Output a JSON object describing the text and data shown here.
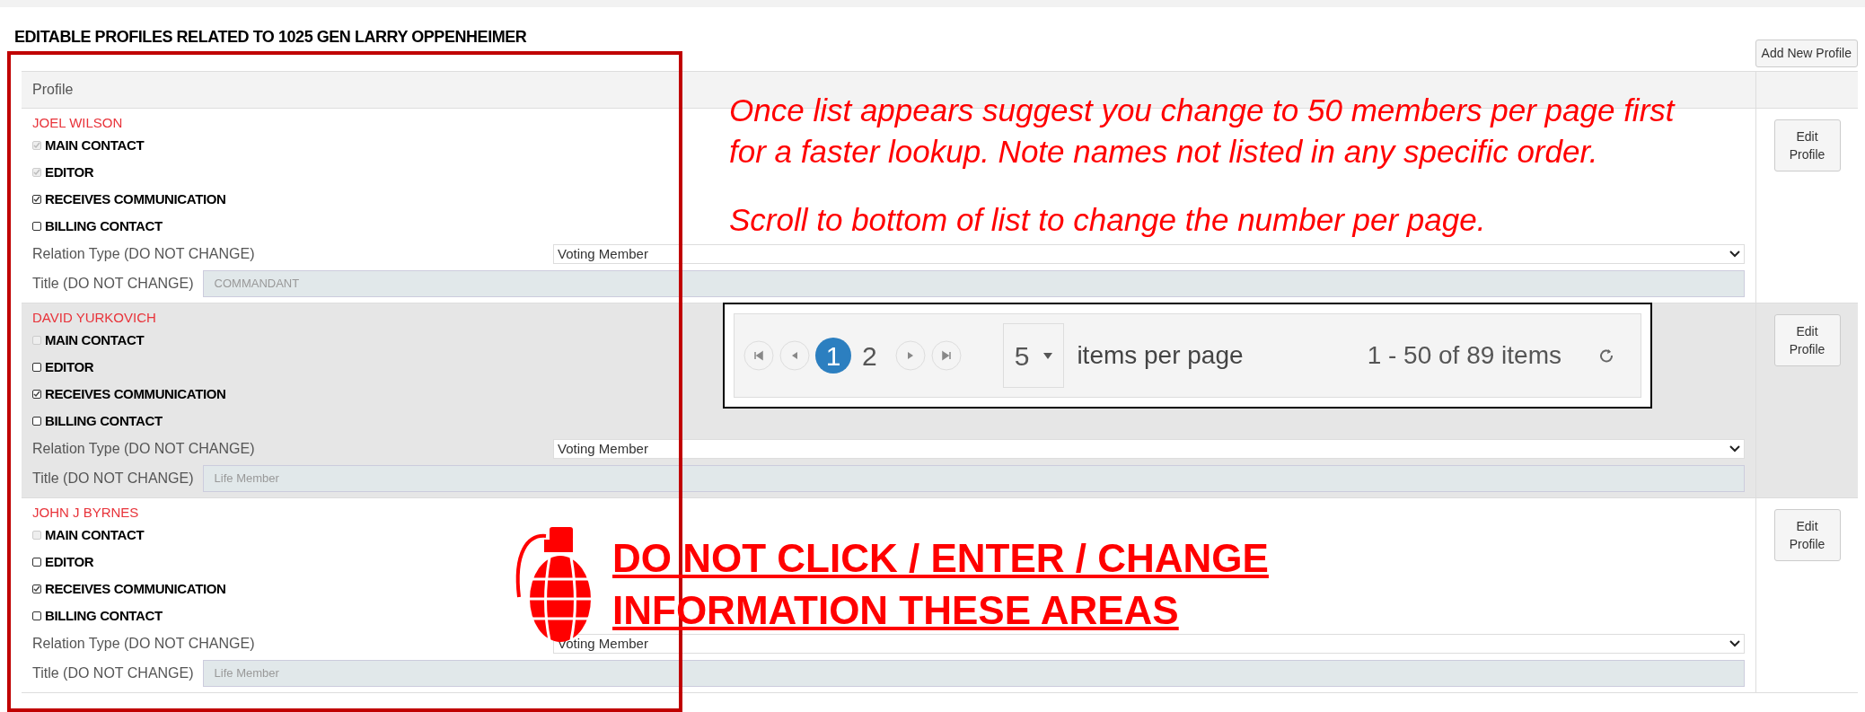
{
  "heading": "EDITABLE PROFILES RELATED TO 1025 GEN LARRY OPPENHEIMER",
  "add_button": "Add New Profile",
  "table": {
    "columns": [
      "Profile"
    ],
    "rows": [
      {
        "name": "JOEL WILSON",
        "flags": [
          {
            "label": "MAIN CONTACT",
            "checked": true,
            "disabled": true
          },
          {
            "label": "EDITOR",
            "checked": true,
            "disabled": true
          },
          {
            "label": "RECEIVES COMMUNICATION",
            "checked": true,
            "disabled": false
          },
          {
            "label": "BILLING CONTACT",
            "checked": false,
            "disabled": false
          }
        ],
        "relation_label": "Relation Type (DO NOT CHANGE)",
        "relation_value": "Voting Member",
        "title_label": "Title (DO NOT CHANGE)",
        "title_value": "COMMANDANT",
        "edit_button": "Edit Profile"
      },
      {
        "name": "DAVID YURKOVICH",
        "flags": [
          {
            "label": "MAIN CONTACT",
            "checked": false,
            "disabled": true
          },
          {
            "label": "EDITOR",
            "checked": false,
            "disabled": false
          },
          {
            "label": "RECEIVES COMMUNICATION",
            "checked": true,
            "disabled": false
          },
          {
            "label": "BILLING CONTACT",
            "checked": false,
            "disabled": false
          }
        ],
        "relation_label": "Relation Type (DO NOT CHANGE)",
        "relation_value": "Voting Member",
        "title_label": "Title (DO NOT CHANGE)",
        "title_value": "Life Member",
        "edit_button": "Edit Profile"
      },
      {
        "name": "JOHN J BYRNES",
        "flags": [
          {
            "label": "MAIN CONTACT",
            "checked": false,
            "disabled": true
          },
          {
            "label": "EDITOR",
            "checked": false,
            "disabled": false
          },
          {
            "label": "RECEIVES COMMUNICATION",
            "checked": true,
            "disabled": false
          },
          {
            "label": "BILLING CONTACT",
            "checked": false,
            "disabled": false
          }
        ],
        "relation_label": "Relation Type (DO NOT CHANGE)",
        "relation_value": "Voting Member",
        "title_label": "Title (DO NOT CHANGE)",
        "title_value": "Life Member",
        "edit_button": "Edit Profile"
      }
    ]
  },
  "annotations": {
    "note_lines": [
      "Once list appears suggest you change to 50 members per page first",
      "for a faster lookup. Note names not listed in any specific order.",
      "Scroll to bottom of list to change the number per page."
    ],
    "pagination": {
      "pages": [
        {
          "label": "1",
          "selected": true
        },
        {
          "label": "2",
          "selected": false
        }
      ],
      "page_size": "5",
      "page_size_label": "items per page",
      "range": "1 - 50 of 89 items"
    },
    "warning_lines": [
      "DO NOT CLICK / ENTER / CHANGE",
      "INFORMATION THESE AREAS"
    ]
  }
}
